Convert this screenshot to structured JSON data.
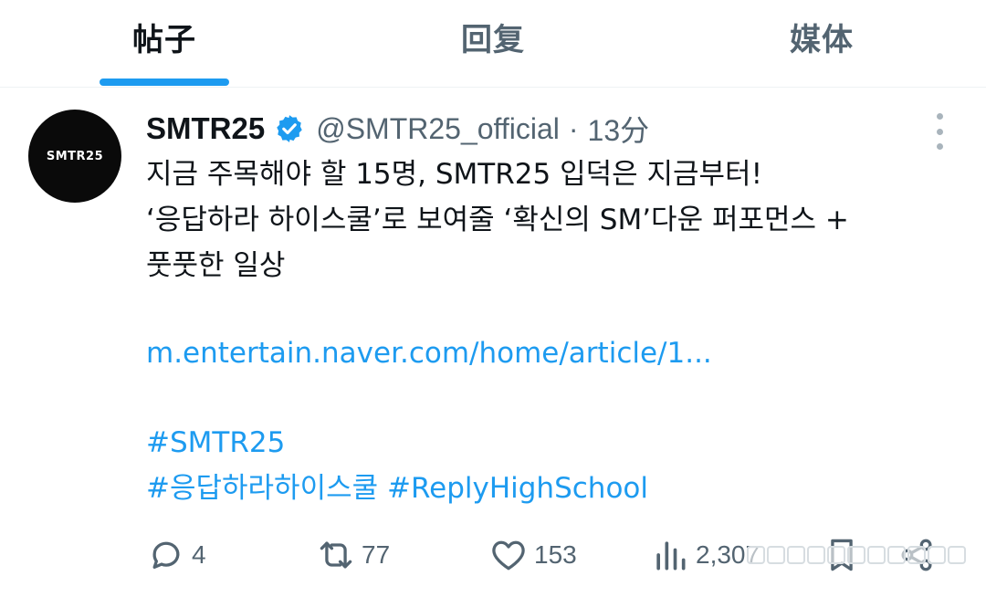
{
  "tabs": [
    {
      "label": "帖子",
      "active": true
    },
    {
      "label": "回复",
      "active": false
    },
    {
      "label": "媒体",
      "active": false
    }
  ],
  "post": {
    "avatar_text": "SMTR25",
    "name": "SMTR25",
    "verified_icon": "verified-badge-icon",
    "handle": "@SMTR25_official",
    "separator": "·",
    "time": "13分",
    "text_lines": [
      "지금 주목해야 할 15명, SMTR25 입덕은 지금부터!",
      "‘응답하라 하이스쿨’로 보여줄 ‘확신의 SM’다운 퍼포먼스 +",
      "풋풋한 일상"
    ],
    "link": "m.entertain.naver.com/home/article/1...",
    "hashtags_line1": "#SMTR25",
    "hashtags_line2": [
      "#응답하라하이스쿨",
      "#ReplyHighSchool"
    ]
  },
  "actions": {
    "reply": {
      "icon": "reply-icon",
      "count": "4"
    },
    "repost": {
      "icon": "repost-icon",
      "count": "77"
    },
    "like": {
      "icon": "heart-icon",
      "count": "153"
    },
    "views": {
      "icon": "views-icon",
      "count": "2,307"
    },
    "bookmark": {
      "icon": "bookmark-icon"
    },
    "share": {
      "icon": "share-icon"
    }
  },
  "colors": {
    "accent": "#1d9bf0",
    "text": "#0f1419",
    "muted": "#536471"
  }
}
